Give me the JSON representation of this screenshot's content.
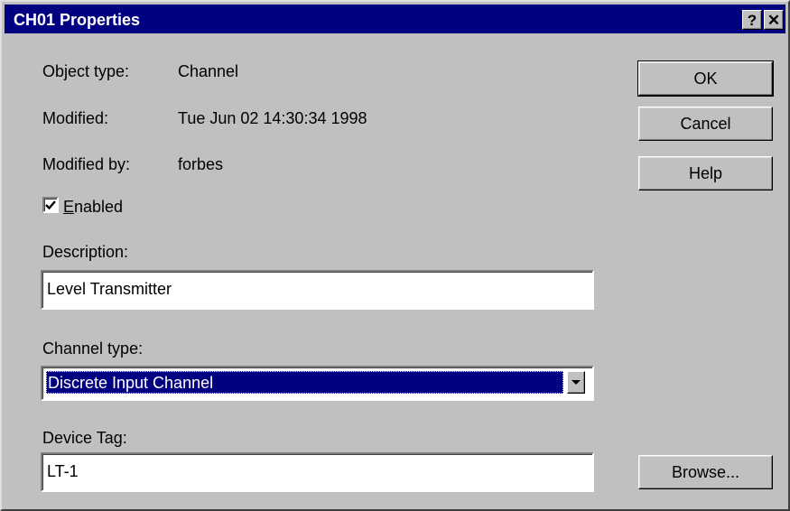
{
  "window": {
    "title": "CH01 Properties",
    "help_button": "?",
    "close_button": "✕"
  },
  "info": {
    "object_type_label": "Object type:",
    "object_type_value": "Channel",
    "modified_label": "Modified:",
    "modified_value": "Tue Jun 02 14:30:34 1998",
    "modified_by_label": "Modified by:",
    "modified_by_value": "forbes"
  },
  "enabled": {
    "label_accel": "E",
    "label_rest": "nabled",
    "checked": true
  },
  "description": {
    "label": "Description:",
    "value": "Level Transmitter"
  },
  "channel_type": {
    "label": "Channel type:",
    "selected": "Discrete Input Channel"
  },
  "device_tag": {
    "label": "Device Tag:",
    "value": "LT-1"
  },
  "buttons": {
    "ok": "OK",
    "cancel": "Cancel",
    "help": "Help",
    "browse": "Browse..."
  },
  "colors": {
    "title_bar": "#000080",
    "dialog_face": "#c0c0c0",
    "selection": "#000080"
  }
}
